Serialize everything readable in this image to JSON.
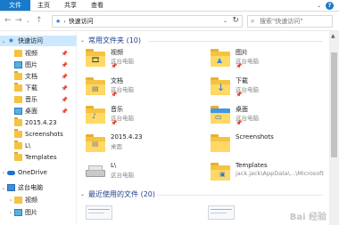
{
  "ribbon": {
    "tabs": [
      "文件",
      "主页",
      "共享",
      "查看"
    ]
  },
  "address": {
    "path": "快速访问"
  },
  "search": {
    "placeholder": "搜索\"快速访问\""
  },
  "sidebar": {
    "items": [
      {
        "label": "快速访问",
        "icon": "star-icon"
      },
      {
        "label": "视频",
        "icon": "video-folder-icon",
        "pinned": true
      },
      {
        "label": "图片",
        "icon": "pictures-folder-icon",
        "pinned": true
      },
      {
        "label": "文档",
        "icon": "documents-folder-icon",
        "pinned": true
      },
      {
        "label": "下载",
        "icon": "downloads-folder-icon",
        "pinned": true
      },
      {
        "label": "音乐",
        "icon": "music-folder-icon",
        "pinned": true
      },
      {
        "label": "桌面",
        "icon": "desktop-folder-icon",
        "pinned": true
      },
      {
        "label": "2015.4.23",
        "icon": "folder-icon"
      },
      {
        "label": "Screenshots",
        "icon": "folder-icon"
      },
      {
        "label": "L\\",
        "icon": "folder-icon"
      },
      {
        "label": "Templates",
        "icon": "folder-icon"
      },
      {
        "label": "OneDrive",
        "icon": "cloud-icon"
      },
      {
        "label": "这台电脑",
        "icon": "computer-icon"
      },
      {
        "label": "视频",
        "icon": "video-folder-icon"
      },
      {
        "label": "图片",
        "icon": "pictures-folder-icon"
      }
    ]
  },
  "groups": {
    "frequent": "常用文件夹 (10)",
    "recent": "最近使用的文件 (20)"
  },
  "folders": [
    {
      "name": "视频",
      "sub": "这台电脑"
    },
    {
      "name": "图片",
      "sub": "这台电脑"
    },
    {
      "name": "文档",
      "sub": "这台电脑"
    },
    {
      "name": "下载",
      "sub": "这台电脑"
    },
    {
      "name": "音乐",
      "sub": "这台电脑"
    },
    {
      "name": "桌面",
      "sub": "这台电脑"
    },
    {
      "name": "2015.4.23",
      "sub": "桌面"
    },
    {
      "name": "Screenshots",
      "sub": ""
    },
    {
      "name": "L\\",
      "sub": "这台电脑"
    },
    {
      "name": "Templates",
      "sub": "jack.jack\\AppData\\...\\Microsoft"
    }
  ],
  "watermark": "Bai 经验"
}
